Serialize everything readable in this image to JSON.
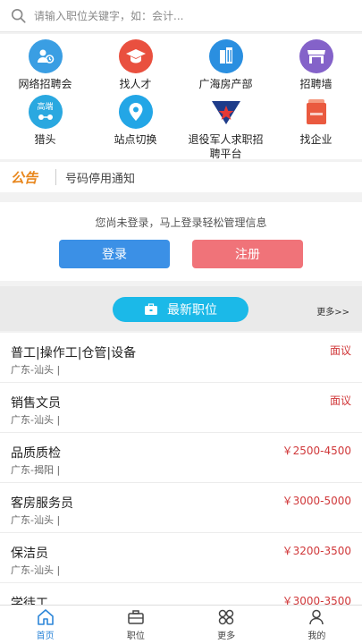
{
  "search": {
    "placeholder": "请输入职位关键字，如：会计..."
  },
  "grid": [
    {
      "label": "网络招聘会",
      "icon": "network-fair-icon",
      "color": "#3a9ee3"
    },
    {
      "label": "找人才",
      "icon": "graduation-cap-icon",
      "color": "#e9503f"
    },
    {
      "label": "广海房产部",
      "icon": "building-icon",
      "color": "#2a8fe0"
    },
    {
      "label": "招聘墙",
      "icon": "storefront-icon",
      "color": "#8462c9"
    },
    {
      "label": "猎头",
      "icon": "headhunter-badge-icon",
      "color": "#2aa8e0",
      "badge": "高端"
    },
    {
      "label": "站点切换",
      "icon": "location-pin-icon",
      "color": "#23a6e6"
    },
    {
      "label": "退役军人求职招聘平台",
      "icon": "veteran-star-icon",
      "color": "#1e3c8a"
    },
    {
      "label": "找企业",
      "icon": "enterprise-card-icon",
      "color": "#ea5a3f"
    }
  ],
  "notice": {
    "brand": "公告",
    "text": "号码停用通知"
  },
  "login": {
    "message": "您尚未登录，马上登录轻松管理信息",
    "login_label": "登录",
    "register_label": "注册"
  },
  "latest": {
    "title": "最新职位",
    "more": "更多>>"
  },
  "jobs": [
    {
      "title": "普工|操作工|仓管|设备",
      "location": "广东-汕头 |",
      "salary": "面议"
    },
    {
      "title": "销售文员",
      "location": "广东-汕头 |",
      "salary": "面议"
    },
    {
      "title": "品质质检",
      "location": "广东-揭阳 |",
      "salary": "￥2500-4500"
    },
    {
      "title": "客房服务员",
      "location": "广东-汕头 |",
      "salary": "￥3000-5000"
    },
    {
      "title": "保洁员",
      "location": "广东-汕头 |",
      "salary": "￥3200-3500"
    },
    {
      "title": "学徒工",
      "location": "",
      "salary": "￥3000-3500"
    }
  ],
  "tabs": [
    {
      "label": "首页",
      "icon": "home-icon"
    },
    {
      "label": "职位",
      "icon": "briefcase-icon"
    },
    {
      "label": "更多",
      "icon": "clover-grid-icon"
    },
    {
      "label": "我的",
      "icon": "user-icon"
    }
  ]
}
